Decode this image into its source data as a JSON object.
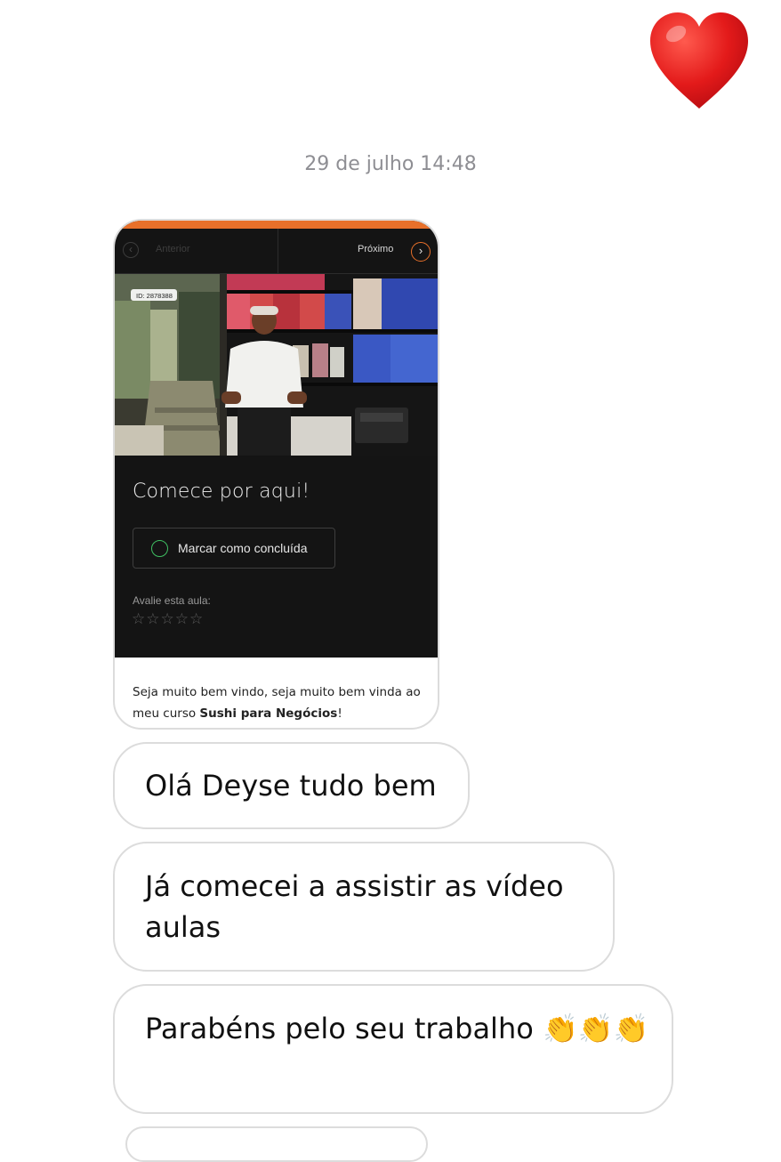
{
  "reaction": {
    "icon": "red-heart-icon",
    "color": "#e01b1b"
  },
  "conversation": {
    "timestamp": "29 de julho 14:48"
  },
  "shared_card": {
    "accent_color": "#e8702a",
    "nav": {
      "prev_label": "Anterior",
      "next_label": "Próximo"
    },
    "video": {
      "id_tag": "ID: 2878388"
    },
    "lesson_title": "Comece por aqui!",
    "mark_complete_label": "Marcar como concluída",
    "rating": {
      "label": "Avalie esta aula:",
      "stars": "☆☆☆☆☆",
      "value": 0,
      "max": 5
    },
    "caption": {
      "prefix": "Seja muito bem vindo, seja muito bem vinda ao meu curso ",
      "bold": "Sushi para Negócios",
      "suffix": "!"
    }
  },
  "messages": [
    {
      "text": "Olá Deyse tudo bem"
    },
    {
      "text": "Já comecei a assistir as vídeo aulas"
    },
    {
      "text": "Parabéns pelo seu trabalho",
      "emoji": "👏👏👏"
    }
  ]
}
